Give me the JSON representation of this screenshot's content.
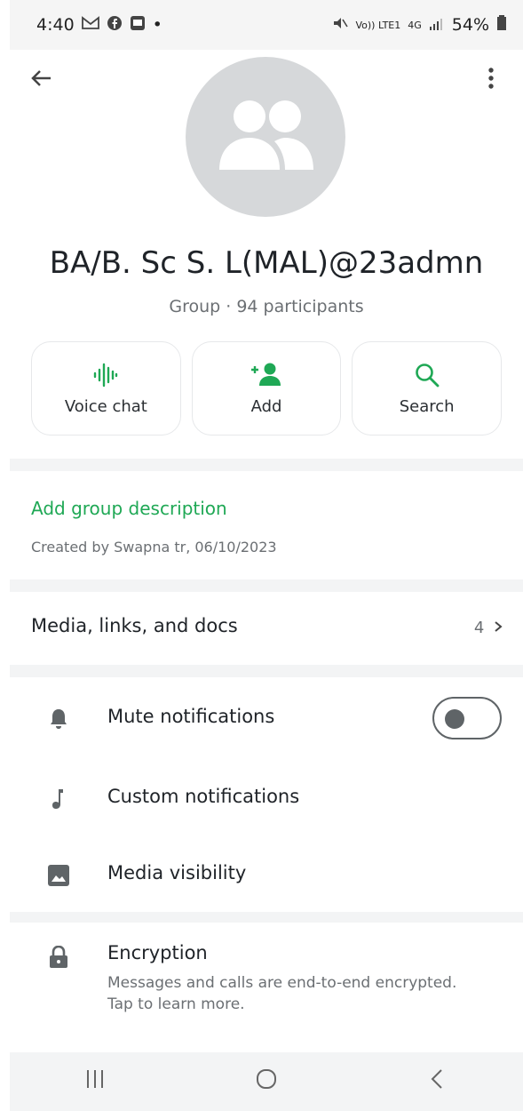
{
  "status_bar": {
    "time": "4:40",
    "volte": "Vo)) LTE1",
    "network": "4G",
    "battery": "54%"
  },
  "header": {
    "back_icon": "arrow-left",
    "more_icon": "dots-vertical"
  },
  "group": {
    "name": "BA/B. Sc S. L(MAL)@23admn",
    "subtitle": "Group · 94 participants"
  },
  "actions": [
    {
      "label": "Voice chat",
      "icon": "waveform-icon"
    },
    {
      "label": "Add",
      "icon": "add-person-icon"
    },
    {
      "label": "Search",
      "icon": "search-icon"
    }
  ],
  "description": {
    "add_label": "Add group description",
    "created": "Created by Swapna tr, 06/10/2023"
  },
  "media": {
    "label": "Media, links, and docs",
    "count": "4"
  },
  "settings": [
    {
      "label": "Mute notifications",
      "icon": "bell-icon"
    },
    {
      "label": "Custom notifications",
      "icon": "music-note-icon"
    },
    {
      "label": "Media visibility",
      "icon": "image-icon"
    }
  ],
  "encryption": {
    "title": "Encryption",
    "description": "Messages and calls are end-to-end encrypted. Tap to learn more."
  },
  "colors": {
    "accent": "#1fa855",
    "muted_text": "#6b6f73",
    "separator": "#f3f4f5"
  }
}
